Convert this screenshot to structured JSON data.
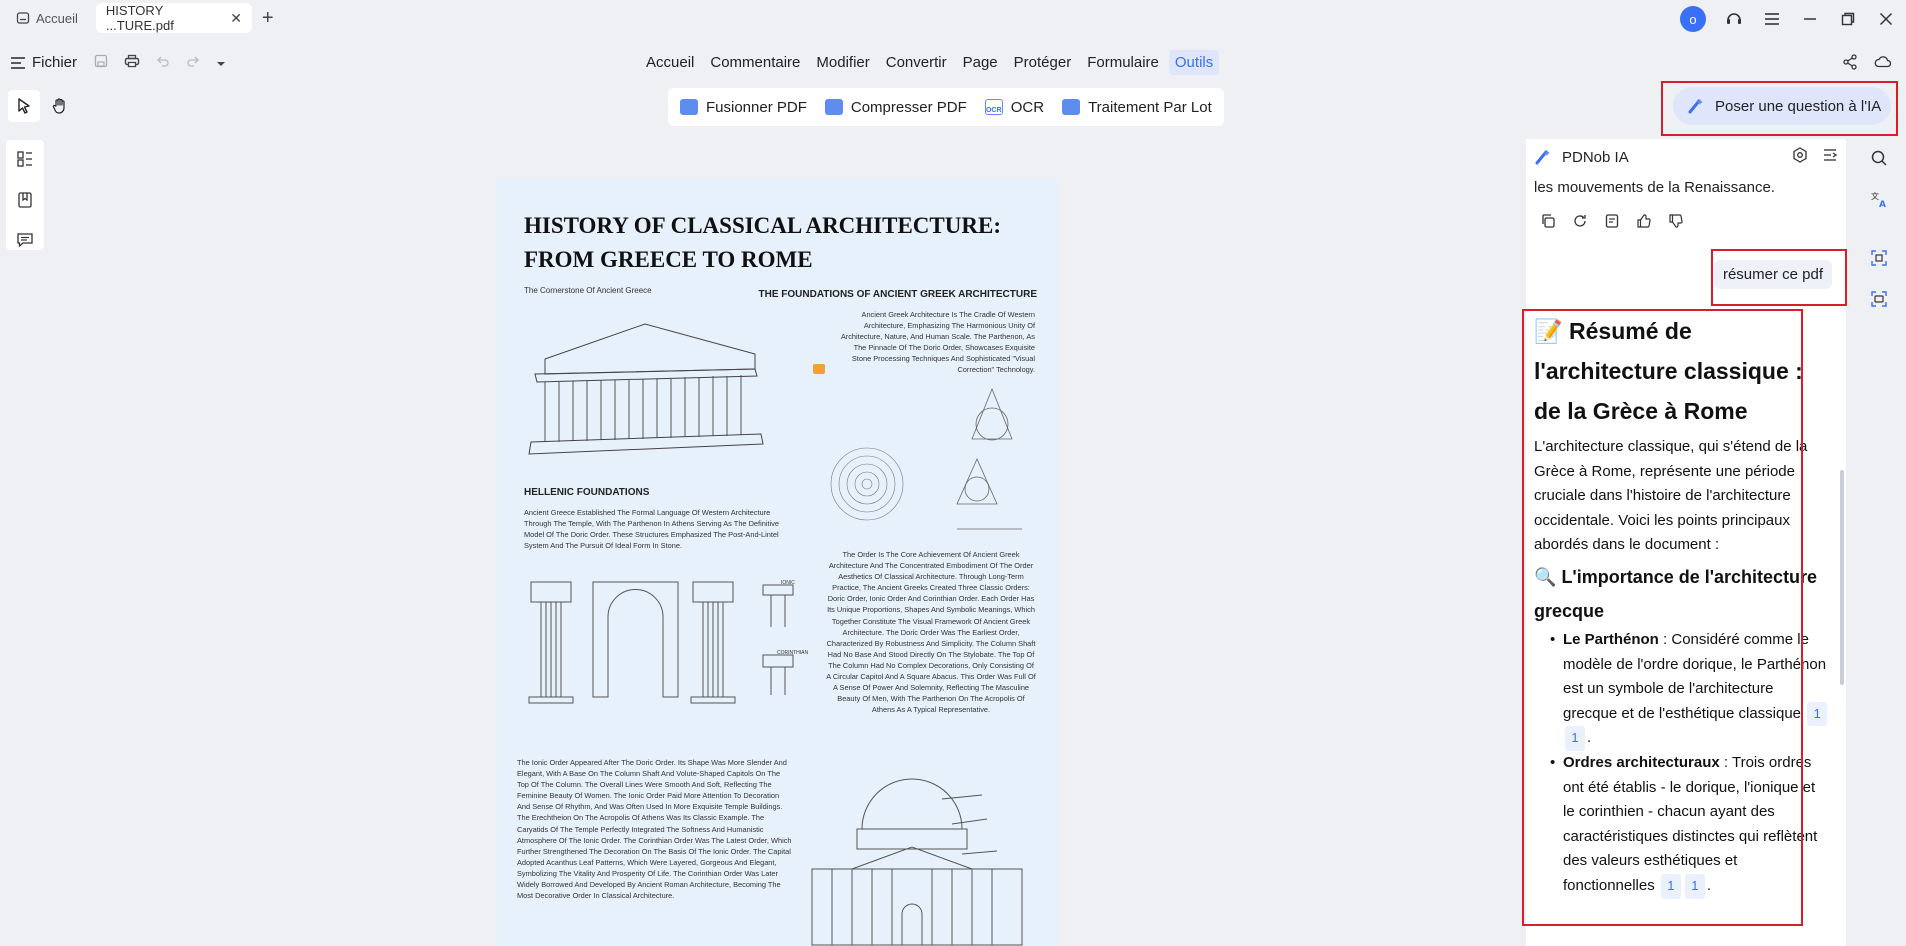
{
  "titlebar": {
    "home_tab": "Accueil",
    "doc_tab": "HISTORY ...TURE.pdf",
    "avatar_letter": "o"
  },
  "menubar": {
    "file_label": "Fichier",
    "items": [
      {
        "label": "Accueil"
      },
      {
        "label": "Commentaire"
      },
      {
        "label": "Modifier"
      },
      {
        "label": "Convertir"
      },
      {
        "label": "Page"
      },
      {
        "label": "Protéger"
      },
      {
        "label": "Formulaire"
      },
      {
        "label": "Outils"
      }
    ],
    "active": "Outils"
  },
  "tools": {
    "merge": "Fusionner PDF",
    "compress": "Compresser PDF",
    "ocr": "OCR",
    "batch": "Traitement Par Lot",
    "ocr_icon_text": "OCR"
  },
  "ai_button": "Poser une question à l'IA",
  "document": {
    "title": "HISTORY OF CLASSICAL  ARCHITECTURE: FROM GREECE TO ROME",
    "subtitle": "The Cornerstone Of Ancient Greece",
    "section1_title": "THE FOUNDATIONS OF ANCIENT GREEK ARCHITECTURE",
    "section1_text": "Ancient Greek Architecture Is The Cradle Of Western Architecture, Emphasizing The Harmonious Unity Of Architecture, Nature, And Human Scale. The Parthenon, As The Pinnacle Of The Doric Order, Showcases Exquisite Stone Processing Techniques And Sophisticated \"Visual Correction\" Technology.",
    "section2_title": "HELLENIC FOUNDATIONS",
    "section2_text": "Ancient Greece Established The Formal Language Of Western Architecture Through The Temple, With The Parthenon In Athens Serving As The Definitive Model Of The Doric Order. These Structures Emphasized The Post-And-Lintel System And The Pursuit Of Ideal Form In Stone.",
    "section3_text": "The Order Is The Core Achievement Of Ancient Greek Architecture And The Concentrated Embodiment Of The Order Aesthetics Of Classical Architecture. Through Long-Term Practice, The Ancient Greeks Created Three Classic Orders: Doric Order, Ionic Order And Corinthian Order. Each Order Has Its Unique Proportions, Shapes And Symbolic Meanings, Which Together Constitute The Visual Framework Of Ancient Greek Architecture. The Doric Order Was The Earliest Order, Characterized By Robustness And Simplicity. The Column Shaft Had No Base And Stood Directly On The Stylobate. The Top Of The Column Had No Complex Decorations, Only Consisting Of A Circular Capitol And A Square Abacus. This Order Was Full Of A Sense Of Power And Solemnity, Reflecting The Masculine Beauty Of Men, With The Parthenon On The Acropolis Of Athens As A Typical Representative.",
    "section4_text": "The Ionic Order Appeared After The Doric Order. Its Shape Was More Slender And Elegant, With A Base On The Column Shaft And Volute-Shaped Capitols On The Top Of The Column. The Overall Lines Were Smooth And Soft, Reflecting The Feminine Beauty Of Women. The Ionic Order Paid More Attention To Decoration And Sense Of Rhythm, And Was Often Used In More Exquisite Temple Buildings. The Erechtheion On The Acropolis Of Athens Was Its Classic Example. The Caryatids Of The Temple Perfectly Integrated The Softness And Humanistic Atmosphere Of The Ionic Order. The Corinthian Order Was The Latest Order, Which Further Strengthened The Decoration On The Basis Of The Ionic Order. The Capital Adopted Acanthus Leaf Patterns, Which Were Layered, Gorgeous And Elegant, Symbolizing The Vitality And Prosperity Of Life. The Corinthian Order Was Later Widely Borrowed And Developed By Ancient Roman Architecture, Becoming The Most Decorative Order In Classical Architecture.",
    "label_ionic": "IONIC",
    "label_corinthian": "CORINTHIAN"
  },
  "chat": {
    "title": "PDNob IA",
    "previous_message_tail": "les mouvements de la Renaissance.",
    "user_message": "résumer ce pdf",
    "answer": {
      "heading_emoji": "📝",
      "heading": "Résumé de l'architecture classique : de la Grèce à Rome",
      "intro": "L'architecture classique, qui s'étend de la Grèce à Rome, représente une période cruciale dans l'histoire de l'architecture occidentale. Voici les points principaux abordés dans le document :",
      "section_emoji": "🔍",
      "section_title": "L'importance de l'architecture grecque",
      "bullets": [
        {
          "term": "Le Parthénon",
          "text": " : Considéré comme le modèle de l'ordre dorique, le Parthénon est un symbole de l'architecture grecque et de l'esthétique classique",
          "refs": [
            "1",
            "1"
          ]
        },
        {
          "term": "Ordres architecturaux",
          "text": " : Trois ordres ont été établis - le dorique, l'ionique et le corinthien - chacun ayant des caractéristiques distinctes qui reflètent des valeurs esthétiques et fonctionnelles",
          "refs": [
            "1",
            "1"
          ]
        }
      ]
    }
  },
  "colors": {
    "accent": "#3a6ff7",
    "highlight_box": "#d81e2a",
    "page_bg": "#e6f1fb"
  },
  "icons": [
    "home-icon",
    "close-icon",
    "plus-icon",
    "headset-icon",
    "hamburger-icon",
    "minimize-icon",
    "maximize-icon",
    "window-close-icon",
    "save-icon",
    "print-icon",
    "undo-icon",
    "redo-icon",
    "share-icon",
    "cloud-icon",
    "cursor-icon",
    "hand-icon",
    "thumbnails-icon",
    "bookmark-icon",
    "comment-icon",
    "ai-sparkle-icon",
    "settings-icon",
    "collapse-icon",
    "copy-icon",
    "refresh-icon",
    "note-icon",
    "thumb-up-icon",
    "thumb-down-icon",
    "search-icon",
    "translate-icon",
    "scan-icon",
    "chat-pdf-icon"
  ]
}
